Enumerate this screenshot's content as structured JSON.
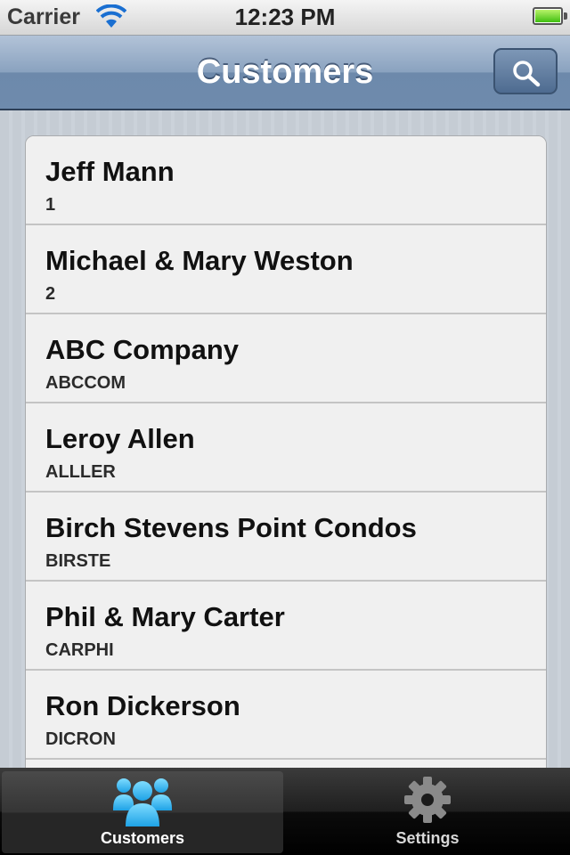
{
  "status_bar": {
    "carrier": "Carrier",
    "time": "12:23 PM"
  },
  "nav_bar": {
    "title": "Customers",
    "search_icon": "search-icon"
  },
  "customers": [
    {
      "name": "Jeff Mann",
      "code": "1"
    },
    {
      "name": "Michael & Mary Weston",
      "code": "2"
    },
    {
      "name": "ABC Company",
      "code": "ABCCOM"
    },
    {
      "name": "Leroy Allen",
      "code": "ALLLER"
    },
    {
      "name": "Birch Stevens Point Condos",
      "code": "BIRSTE"
    },
    {
      "name": "Phil & Mary Carter",
      "code": "CARPHI"
    },
    {
      "name": "Ron Dickerson",
      "code": "DICRON"
    }
  ],
  "tab_bar": {
    "tabs": [
      {
        "label": "Customers",
        "icon": "people-icon",
        "active": true
      },
      {
        "label": "Settings",
        "icon": "gear-icon",
        "active": false
      }
    ]
  },
  "colors": {
    "nav_bar": "#7d97b6",
    "tab_active_icon": "#2fb6f0",
    "battery": "#3fbf10"
  }
}
